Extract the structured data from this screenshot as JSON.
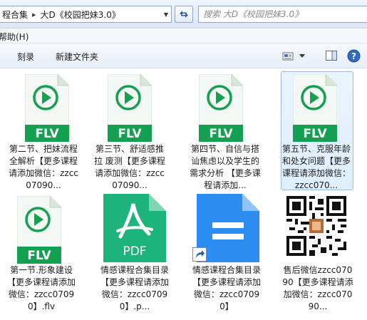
{
  "address": {
    "crumbs": [
      "程合集",
      "大D《校园把妹3.0》"
    ],
    "search_placeholder": "搜索 大D《校园把妹3.0》"
  },
  "menu": {
    "help_label": "帮助(H)"
  },
  "toolbar": {
    "burn_label": "刻录",
    "new_folder_label": "新建文件夹"
  },
  "files": [
    {
      "type": "FLV",
      "name": "第二节、把妹流程全解析【更多课程请添加微信：zzcc07090..."
    },
    {
      "type": "FLV",
      "name": "第三节、舒适感推拉 废测【更多课程请添加微信：zzcc07090..."
    },
    {
      "type": "FLV",
      "name": "第四节、自信与搭讪焦虑以及学生的需求分析 【更多课程请添加..."
    },
    {
      "type": "FLV",
      "name": "第五节、克服年龄和处女问题【更多课程请添加微信：zzcc070..."
    },
    {
      "type": "FLV",
      "name": "第一节.形象建设【更多课程请添加微信：zzcc07090】.flv"
    },
    {
      "type": "PDF",
      "name": "情感课程合集目录【更多课程请添加微信：zzcc07090】.p..."
    },
    {
      "type": "DOC",
      "name": "情感课程合集目录【更多课程请添加微信：zzcc07090】"
    },
    {
      "type": "QR",
      "name": "售后微信zzcc07090【更多课程请添加微信：zzcc07090..."
    }
  ],
  "colors": {
    "flv_green": "#13a050",
    "pdf_teal": "#1db47c",
    "doc_blue": "#2c8cf0"
  }
}
